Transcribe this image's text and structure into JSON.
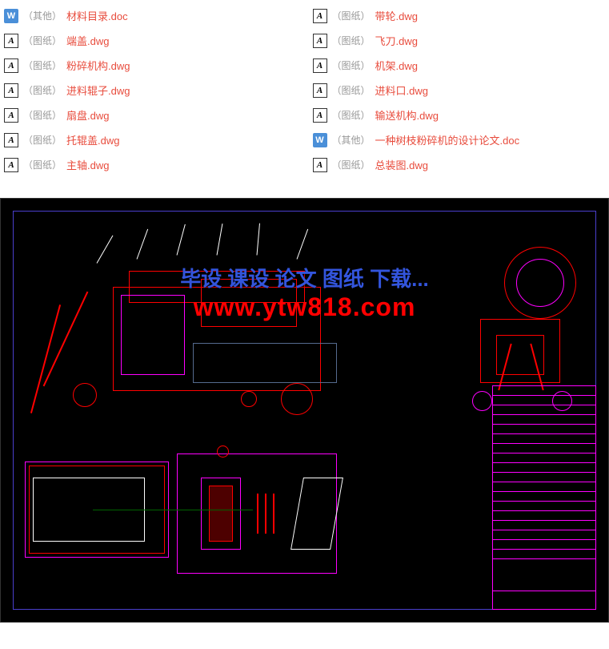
{
  "files": {
    "left": [
      {
        "icon": "word",
        "tag": "（其他）",
        "name": "材料目录.doc"
      },
      {
        "icon": "dwg",
        "tag": "（图纸）",
        "name": "端盖.dwg"
      },
      {
        "icon": "dwg",
        "tag": "（图纸）",
        "name": "粉碎机构.dwg"
      },
      {
        "icon": "dwg",
        "tag": "（图纸）",
        "name": "进料辊子.dwg"
      },
      {
        "icon": "dwg",
        "tag": "（图纸）",
        "name": "扇盘.dwg"
      },
      {
        "icon": "dwg",
        "tag": "（图纸）",
        "name": "托辊盖.dwg"
      },
      {
        "icon": "dwg",
        "tag": "（图纸）",
        "name": "主轴.dwg"
      }
    ],
    "right": [
      {
        "icon": "dwg",
        "tag": "（图纸）",
        "name": "带轮.dwg"
      },
      {
        "icon": "dwg",
        "tag": "（图纸）",
        "name": "飞刀.dwg"
      },
      {
        "icon": "dwg",
        "tag": "（图纸）",
        "name": "机架.dwg"
      },
      {
        "icon": "dwg",
        "tag": "（图纸）",
        "name": "进料口.dwg"
      },
      {
        "icon": "dwg",
        "tag": "（图纸）",
        "name": "输送机构.dwg"
      },
      {
        "icon": "word",
        "tag": "（其他）",
        "name": "一种树枝粉碎机的设计论文.doc"
      },
      {
        "icon": "dwg",
        "tag": "（图纸）",
        "name": "总装图.dwg"
      }
    ]
  },
  "icon_labels": {
    "word": "W",
    "dwg": "A"
  },
  "watermark": {
    "line1": "毕设 课设 论文 图纸 下载...",
    "line2": "www.ytw818.com"
  }
}
